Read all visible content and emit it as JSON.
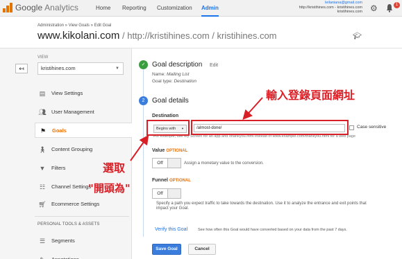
{
  "app": {
    "logo_google": "Google",
    "logo_product": "Analytics",
    "nav": [
      {
        "label": "Home"
      },
      {
        "label": "Reporting"
      },
      {
        "label": "Customization"
      },
      {
        "label": "Admin"
      }
    ],
    "account_email": "leilaniana@gmail.com",
    "account_line2": "http://kristihines.com - kristihines.com",
    "account_line3": "kristihines.com",
    "notification_count": "1",
    "brand_color": "#e37400",
    "accent_color": "#1a73e8"
  },
  "header": {
    "breadcrumb": "Administration » View Goals » Edit Goal",
    "title_main": "www.kikolani.com",
    "title_sub": " / http://kristihines.com / kristihines.com"
  },
  "sidebar": {
    "view_label": "VIEW",
    "view_value": "kristihines.com",
    "items": [
      {
        "label": "View Settings",
        "icon": "document-icon"
      },
      {
        "label": "User Management",
        "icon": "users-icon"
      },
      {
        "label": "Goals",
        "icon": "flag-icon",
        "active": true
      },
      {
        "label": "Content Grouping",
        "icon": "person-icon"
      },
      {
        "label": "Filters",
        "icon": "filter-icon"
      },
      {
        "label": "Channel Settings",
        "icon": "channel-icon"
      },
      {
        "label": "Ecommerce Settings",
        "icon": "cart-icon"
      }
    ],
    "section_label": "PERSONAL TOOLS & ASSETS",
    "section_items": [
      {
        "label": "Segments",
        "icon": "segments-icon"
      },
      {
        "label": "Annotations",
        "icon": "annotations-icon"
      }
    ]
  },
  "goal_description": {
    "title": "Goal description",
    "edit": "Edit",
    "name_label": "Name:",
    "name_value": "Mailing List",
    "type_label": "Goal type:",
    "type_value": "Destination"
  },
  "goal_details": {
    "step_number": "2",
    "title": "Goal details",
    "destination_label": "Destination",
    "match_type": "Begins with",
    "destination_value": "/almost-done/",
    "case_sensitive": "Case sensitive",
    "hint": "For example, use My Screen for an app and /thankyou.html instead of www.example.com/thankyou.html for a web page",
    "value_label": "Value",
    "optional": "OPTIONAL",
    "value_toggle": "Off",
    "value_desc": "Assign a monetary value to the conversion.",
    "funnel_label": "Funnel",
    "funnel_toggle": "Off",
    "funnel_desc_1": "Specify a path you expect traffic to take towards the destination. Use it to analyze the entrance and exit points that",
    "funnel_desc_2": "impact your Goal.",
    "verify_link": "Verify this Goal",
    "verify_desc": "See how often this Goal would have converted based on your data from the past 7 days.",
    "save": "Save Goal",
    "cancel": "Cancel"
  },
  "annotations": {
    "enter_url": "輸入登錄頁面網址",
    "select_line1": "選取",
    "select_line2": "\"開頭為\"",
    "color": "#d91f26"
  }
}
